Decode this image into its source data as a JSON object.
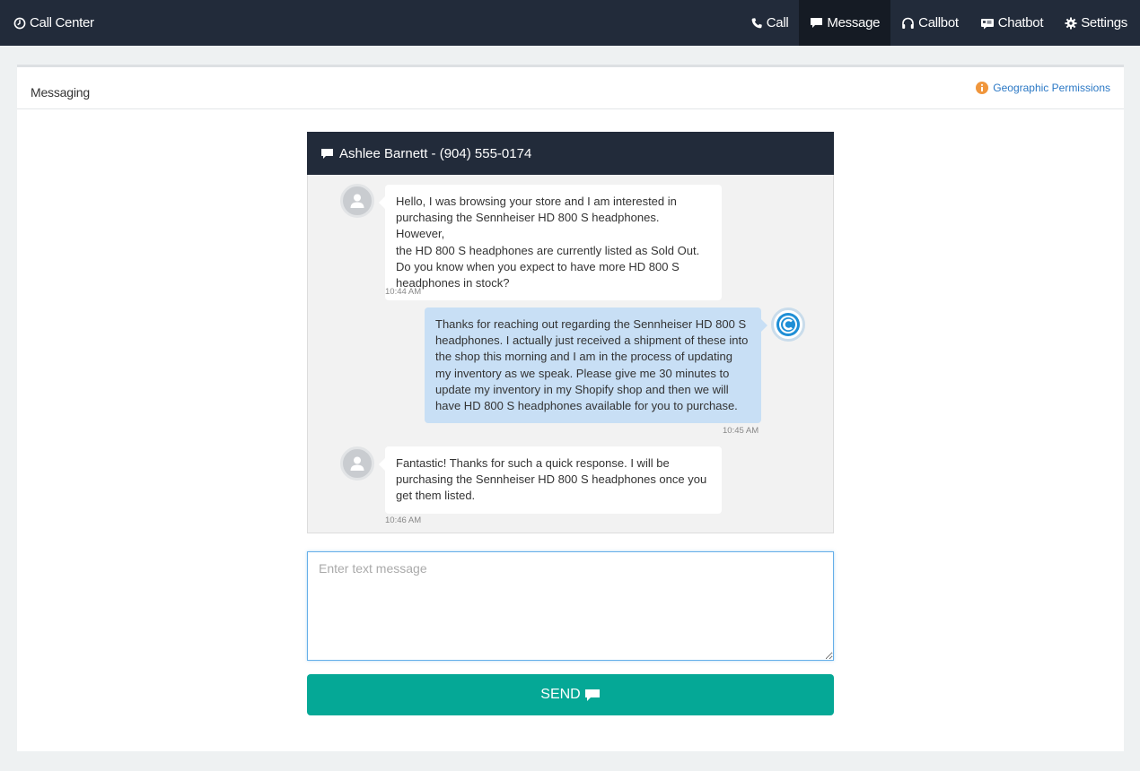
{
  "navbar": {
    "brand": "Call Center",
    "items": [
      {
        "label": "Call",
        "icon": "phone-icon"
      },
      {
        "label": "Message",
        "icon": "chat-bubble-icon",
        "active": true
      },
      {
        "label": "Callbot",
        "icon": "headphones-icon"
      },
      {
        "label": "Chatbot",
        "icon": "chatbot-icon"
      },
      {
        "label": "Settings",
        "icon": "gear-icon"
      }
    ]
  },
  "panel": {
    "title": "Messaging",
    "geo_link": "Geographic Permissions"
  },
  "conversation": {
    "header": "Ashlee Barnett - (904) 555-0174",
    "messages": [
      {
        "from": "customer",
        "lines": [
          "Hello, I was browsing your store and I am interested in",
          "purchasing the Sennheiser HD 800 S headphones. However,",
          "the HD 800 S headphones are currently listed as Sold Out.",
          "Do you know when you expect to have more HD 800 S",
          "headphones in stock?"
        ],
        "time": "10:44 AM"
      },
      {
        "from": "agent",
        "lines": [
          "Thanks for reaching out regarding the Sennheiser HD 800 S",
          "headphones. I actually just received a shipment of these into",
          "the shop this morning and I am in the process of updating",
          "my inventory as we speak. Please give me 30 minutes to",
          "update my inventory in my Shopify shop and then we will",
          "have HD 800 S headphones available for you to purchase."
        ],
        "time": "10:45 AM"
      },
      {
        "from": "customer",
        "lines": [
          "Fantastic! Thanks for such a quick response. I will be",
          "purchasing the Sennheiser HD 800 S headphones once you",
          "get them listed."
        ],
        "time": "10:46 AM"
      }
    ]
  },
  "composer": {
    "placeholder": "Enter text message",
    "value": ""
  },
  "send_button": {
    "label": "SEND"
  },
  "colors": {
    "navbar": "#222b3a",
    "active_nav": "#151b24",
    "send": "#05a896",
    "agent_bubble": "#c8dff5",
    "link": "#2b78c5",
    "info_icon": "#f0963c"
  }
}
